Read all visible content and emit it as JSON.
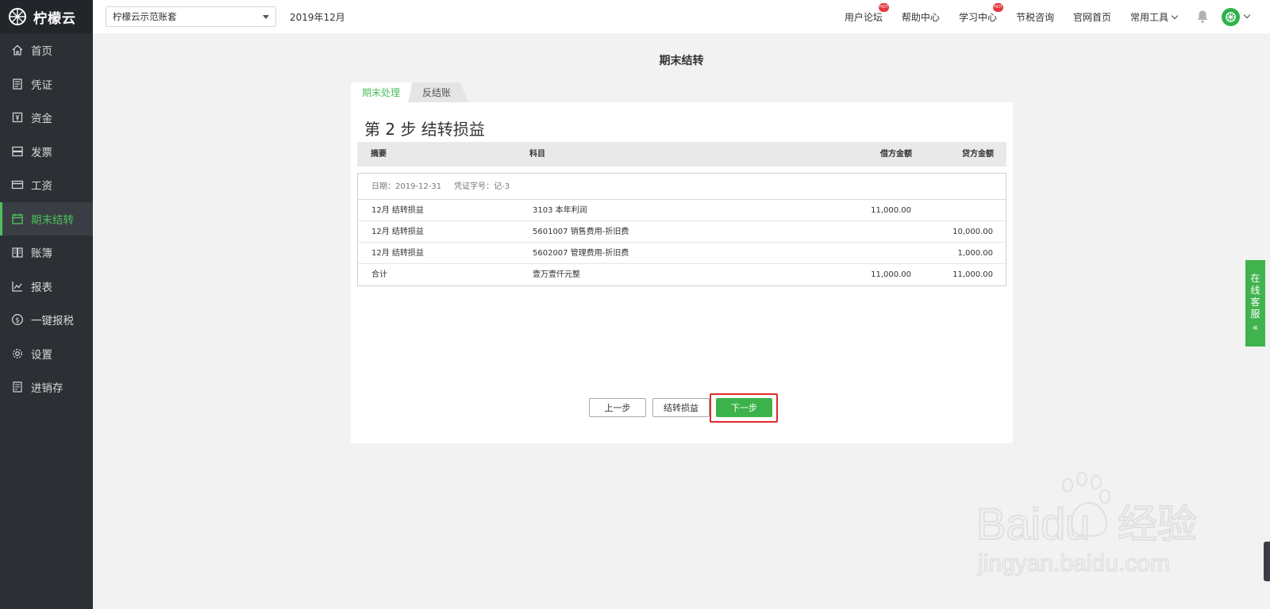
{
  "app": {
    "name": "柠檬云"
  },
  "sidebar": {
    "items": [
      {
        "label": "首页",
        "icon": "home-icon"
      },
      {
        "label": "凭证",
        "icon": "voucher-icon"
      },
      {
        "label": "资金",
        "icon": "fund-icon"
      },
      {
        "label": "发票",
        "icon": "invoice-icon"
      },
      {
        "label": "工资",
        "icon": "salary-card-icon"
      },
      {
        "label": "期末结转",
        "icon": "calendar-icon",
        "active": true
      },
      {
        "label": "账簿",
        "icon": "book-icon"
      },
      {
        "label": "报表",
        "icon": "chart-line-icon"
      },
      {
        "label": "一键报税",
        "icon": "dollar-circle-icon"
      },
      {
        "label": "设置",
        "icon": "gear-icon"
      },
      {
        "label": "进销存",
        "icon": "inventory-icon"
      }
    ]
  },
  "topbar": {
    "account_set": "柠檬云示范账套",
    "period": "2019年12月",
    "links": [
      {
        "label": "用户论坛",
        "hot": true
      },
      {
        "label": "帮助中心",
        "hot": false
      },
      {
        "label": "学习中心",
        "hot": true
      },
      {
        "label": "节税咨询",
        "hot": false
      },
      {
        "label": "官网首页",
        "hot": false
      }
    ],
    "tools_label": "常用工具",
    "hot_badge": "HOT"
  },
  "page": {
    "title": "期末结转",
    "tabs": {
      "active": "期末处理",
      "inactive": "反结账"
    },
    "step_title": "第 2 步 结转损益",
    "columns": {
      "summary": "摘要",
      "account": "科目",
      "debit": "借方金额",
      "credit": "贷方金额"
    },
    "voucher": {
      "date": "日期：2019-12-31",
      "number": "凭证字号：记-3",
      "rows": [
        {
          "summary": "12月 结转损益",
          "account": "3103 本年利润",
          "debit": "11,000.00",
          "credit": ""
        },
        {
          "summary": "12月 结转损益",
          "account": "5601007 销售费用-折旧费",
          "debit": "",
          "credit": "10,000.00"
        },
        {
          "summary": "12月 结转损益",
          "account": "5602007 管理费用-折旧费",
          "debit": "",
          "credit": "1,000.00"
        },
        {
          "summary": "合计",
          "account": "壹万壹仟元整",
          "debit": "11,000.00",
          "credit": "11,000.00"
        }
      ]
    },
    "buttons": {
      "prev": "上一步",
      "transfer": "结转损益",
      "next": "下一步"
    }
  },
  "service": {
    "label": [
      "在",
      "线",
      "客",
      "服"
    ],
    "arrows": "«"
  },
  "watermark": {
    "brand": "Baidu",
    "cn": "经验",
    "url": "jingyan.baidu.com"
  },
  "colors": {
    "accent": "#4cbf5b",
    "sidebar_bg": "#2c2f34",
    "highlight": "#e02b2b"
  }
}
